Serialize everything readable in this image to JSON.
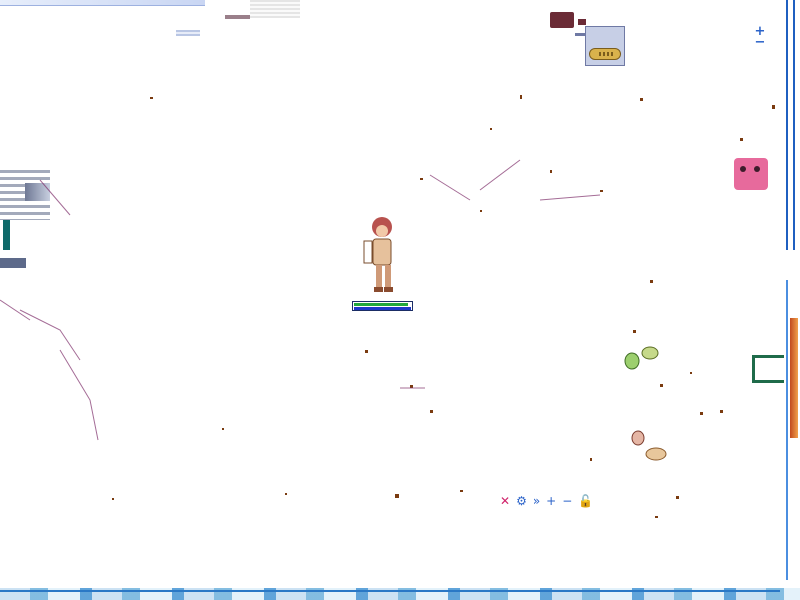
{
  "hud": {
    "zoom_in_label": "+",
    "zoom_out_label": "−"
  },
  "player": {
    "hp_fraction": 0.95,
    "sp_fraction": 1.0
  },
  "skill_bar": [
    {
      "icon": "close-x-icon",
      "glyph": "✕",
      "color": "#d0246b"
    },
    {
      "icon": "gear-icon",
      "glyph": "⚙",
      "color": "#2a62c9"
    },
    {
      "icon": "fast-forward-icon",
      "glyph": "»",
      "color": "#2a62c9"
    },
    {
      "icon": "plus-icon",
      "glyph": "+",
      "color": "#2a62c9"
    },
    {
      "icon": "minus-icon",
      "glyph": "−",
      "color": "#2a62c9"
    },
    {
      "icon": "lock-icon",
      "glyph": "🔓",
      "color": "#2a62c9"
    }
  ],
  "colors": {
    "accent": "#2a62c9",
    "hp": "#22a83c",
    "sp": "#1e38c9"
  }
}
